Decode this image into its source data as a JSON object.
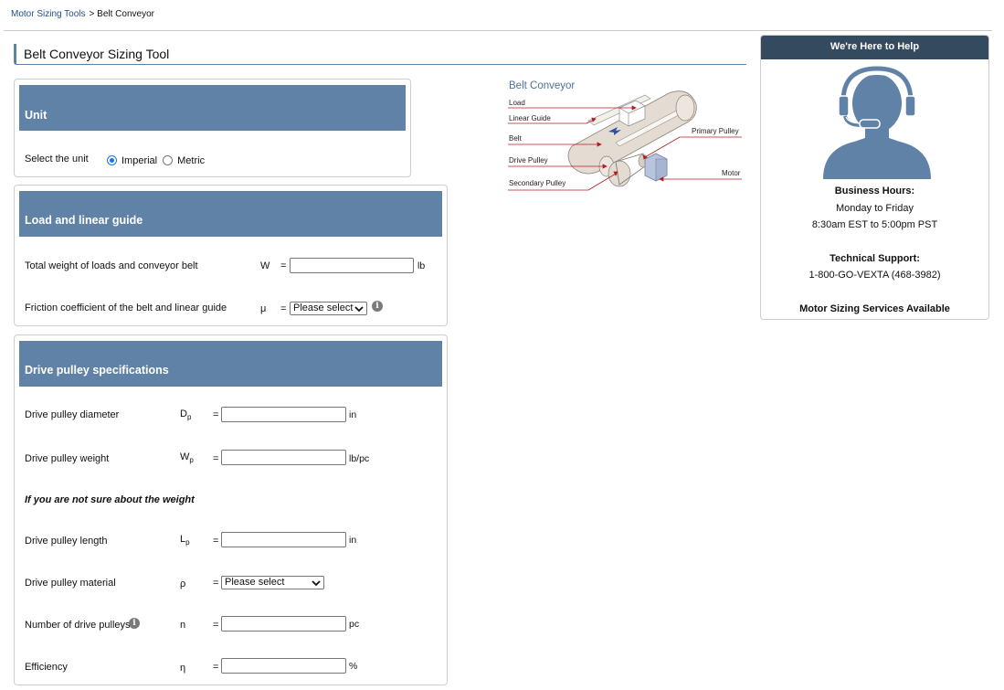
{
  "breadcrumb": {
    "parent": "Motor Sizing Tools",
    "separator": ">",
    "current": "Belt Conveyor"
  },
  "page_title": "Belt Conveyor Sizing Tool",
  "unit_section": {
    "header": "Unit",
    "label": "Select the unit",
    "options": [
      {
        "label": "Imperial",
        "checked": true
      },
      {
        "label": "Metric",
        "checked": false
      }
    ]
  },
  "load_section": {
    "header": "Load and linear guide",
    "rows": [
      {
        "label": "Total weight of loads and conveyor belt",
        "symbol": "W",
        "equals": "=",
        "value": "",
        "unit": "lb"
      },
      {
        "label": "Friction coefficient of the belt and linear guide",
        "symbol": "μ",
        "equals": "=",
        "select_value": "Please select"
      }
    ]
  },
  "drive_section": {
    "header": "Drive pulley specifications",
    "diameter": {
      "label": "Drive pulley diameter",
      "symbol": "D",
      "sub": "p",
      "equals": "=",
      "value": "",
      "unit": "in"
    },
    "weight": {
      "label": "Drive pulley weight",
      "symbol": "W",
      "sub": "p",
      "equals": "=",
      "value": "",
      "unit": "lb/pc"
    },
    "note": "If you are not sure about the weight",
    "length": {
      "label": "Drive pulley length",
      "symbol": "L",
      "sub": "p",
      "equals": "=",
      "value": "",
      "unit": "in"
    },
    "material": {
      "label": "Drive pulley material",
      "symbol": "ρ",
      "equals": "=",
      "select_value": "Please select"
    },
    "count": {
      "label": "Number of drive pulleys",
      "symbol": "n",
      "equals": "=",
      "value": "",
      "unit": "pc"
    },
    "efficiency": {
      "label": "Efficiency",
      "symbol": "η",
      "equals": "=",
      "value": "",
      "unit": "%"
    }
  },
  "diagram": {
    "title": "Belt Conveyor",
    "labels": {
      "load": "Load",
      "linear_guide": "Linear Guide",
      "belt": "Belt",
      "drive_pulley": "Drive Pulley",
      "secondary_pulley": "Secondary Pulley",
      "primary_pulley": "Primary Pulley",
      "motor": "Motor"
    }
  },
  "help": {
    "header": "We're Here to Help",
    "hours_title": "Business Hours:",
    "days": "Monday to Friday",
    "hours": "8:30am EST to 5:00pm PST",
    "support_title": "Technical Support:",
    "phone": "1-800-GO-VEXTA (468-3982)",
    "services": "Motor Sizing Services Available"
  },
  "colors": {
    "section_header": "#5f82a6",
    "help_header": "#344a5f",
    "link": "#1f4e8c",
    "radio_accent": "#1a73e8"
  }
}
